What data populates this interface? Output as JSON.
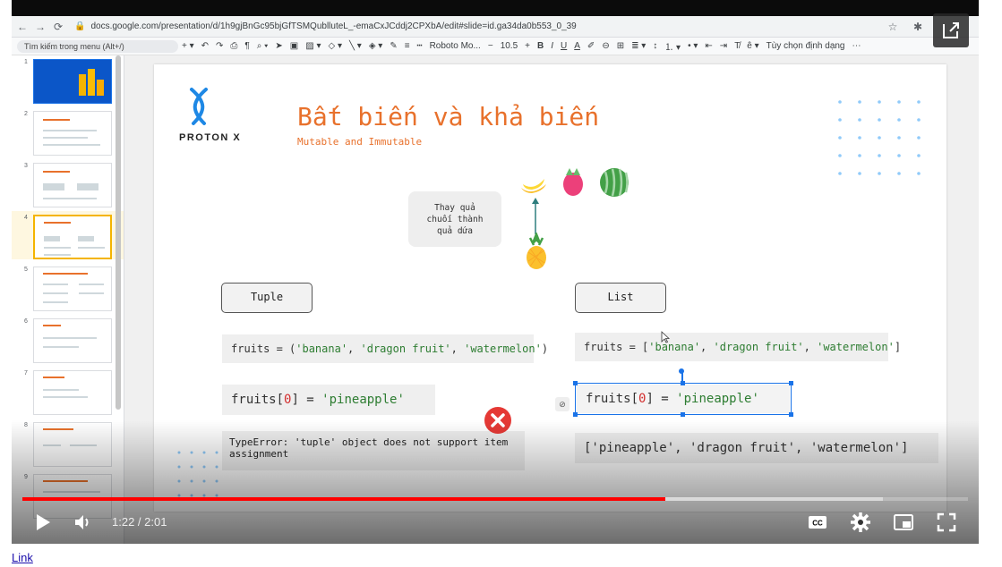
{
  "browser": {
    "url": "docs.google.com/presentation/d/1h9gjBnGc95bjGfTSMQublluteL_-emaCxJCddj2CPXbA/edit#slide=id.ga34da0b553_0_39",
    "back_icon": "back-arrow-icon",
    "forward_icon": "forward-arrow-icon",
    "reload_icon": "reload-icon"
  },
  "toolbar": {
    "menu_search_placeholder": "Tìm kiếm trong menu (Alt+/)",
    "font_name": "Roboto Mo...",
    "font_size": "10.5",
    "format_options": "Tùy chọn định dạng"
  },
  "thumbnails": [
    {
      "num": "1"
    },
    {
      "num": "2"
    },
    {
      "num": "3"
    },
    {
      "num": "4"
    },
    {
      "num": "5"
    },
    {
      "num": "6"
    },
    {
      "num": "7"
    },
    {
      "num": "8"
    },
    {
      "num": "9"
    }
  ],
  "slide": {
    "logo_text": "PROTON X",
    "title": "Bất biến và khả biến",
    "subtitle": "Mutable and Immutable",
    "note_line1": "Thay quả",
    "note_line2": "chuối thành",
    "note_line3": "quả dứa",
    "tuple_label": "Tuple",
    "list_label": "List",
    "tuple_code": {
      "prefix": "fruits = (",
      "s1": "'banana'",
      "sep1": ", ",
      "s2": "'dragon fruit'",
      "sep2": ", ",
      "s3": "'watermelon'",
      "suffix": ")"
    },
    "list_code": {
      "prefix": "fruits = [",
      "s1": "'banana'",
      "sep1": ", ",
      "s2": "'dragon fruit'",
      "sep2": ", ",
      "s3": "'watermelon'",
      "suffix": "]"
    },
    "tuple_assign": {
      "prefix": "fruits[",
      "index": "0",
      "mid": "] = ",
      "value": "'pineapple'"
    },
    "list_assign": {
      "prefix": "fruits[",
      "index": "0",
      "mid": "] = ",
      "value": "'pineapple'"
    },
    "error_text": "TypeError: 'tuple' object does not support item assignment",
    "list_result": "['pineapple', 'dragon fruit', 'watermelon']"
  },
  "video": {
    "time": "1:22 / 2:01",
    "progress_fraction": 0.68,
    "buffer_fraction": 0.91
  },
  "link_text": "Link",
  "colors": {
    "accent_orange": "#e8712c",
    "string_green": "#2e7d32",
    "progress_red": "#ff0000",
    "selection_blue": "#1a73e8"
  }
}
